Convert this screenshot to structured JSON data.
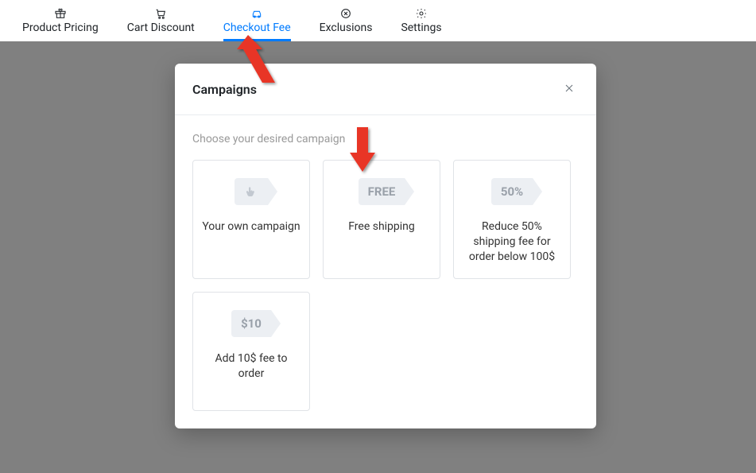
{
  "tabs": [
    {
      "label": "Product Pricing"
    },
    {
      "label": "Cart Discount"
    },
    {
      "label": "Checkout Fee"
    },
    {
      "label": "Exclusions"
    },
    {
      "label": "Settings"
    }
  ],
  "modal": {
    "title": "Campaigns",
    "subtitle": "Choose your desired campaign",
    "cards": [
      {
        "badge": "",
        "label": "Your own campaign"
      },
      {
        "badge": "FREE",
        "label": "Free shipping"
      },
      {
        "badge": "50%",
        "label": "Reduce 50% shipping fee for order below 100$"
      },
      {
        "badge": "$10",
        "label": "Add 10$ fee to order"
      }
    ]
  }
}
